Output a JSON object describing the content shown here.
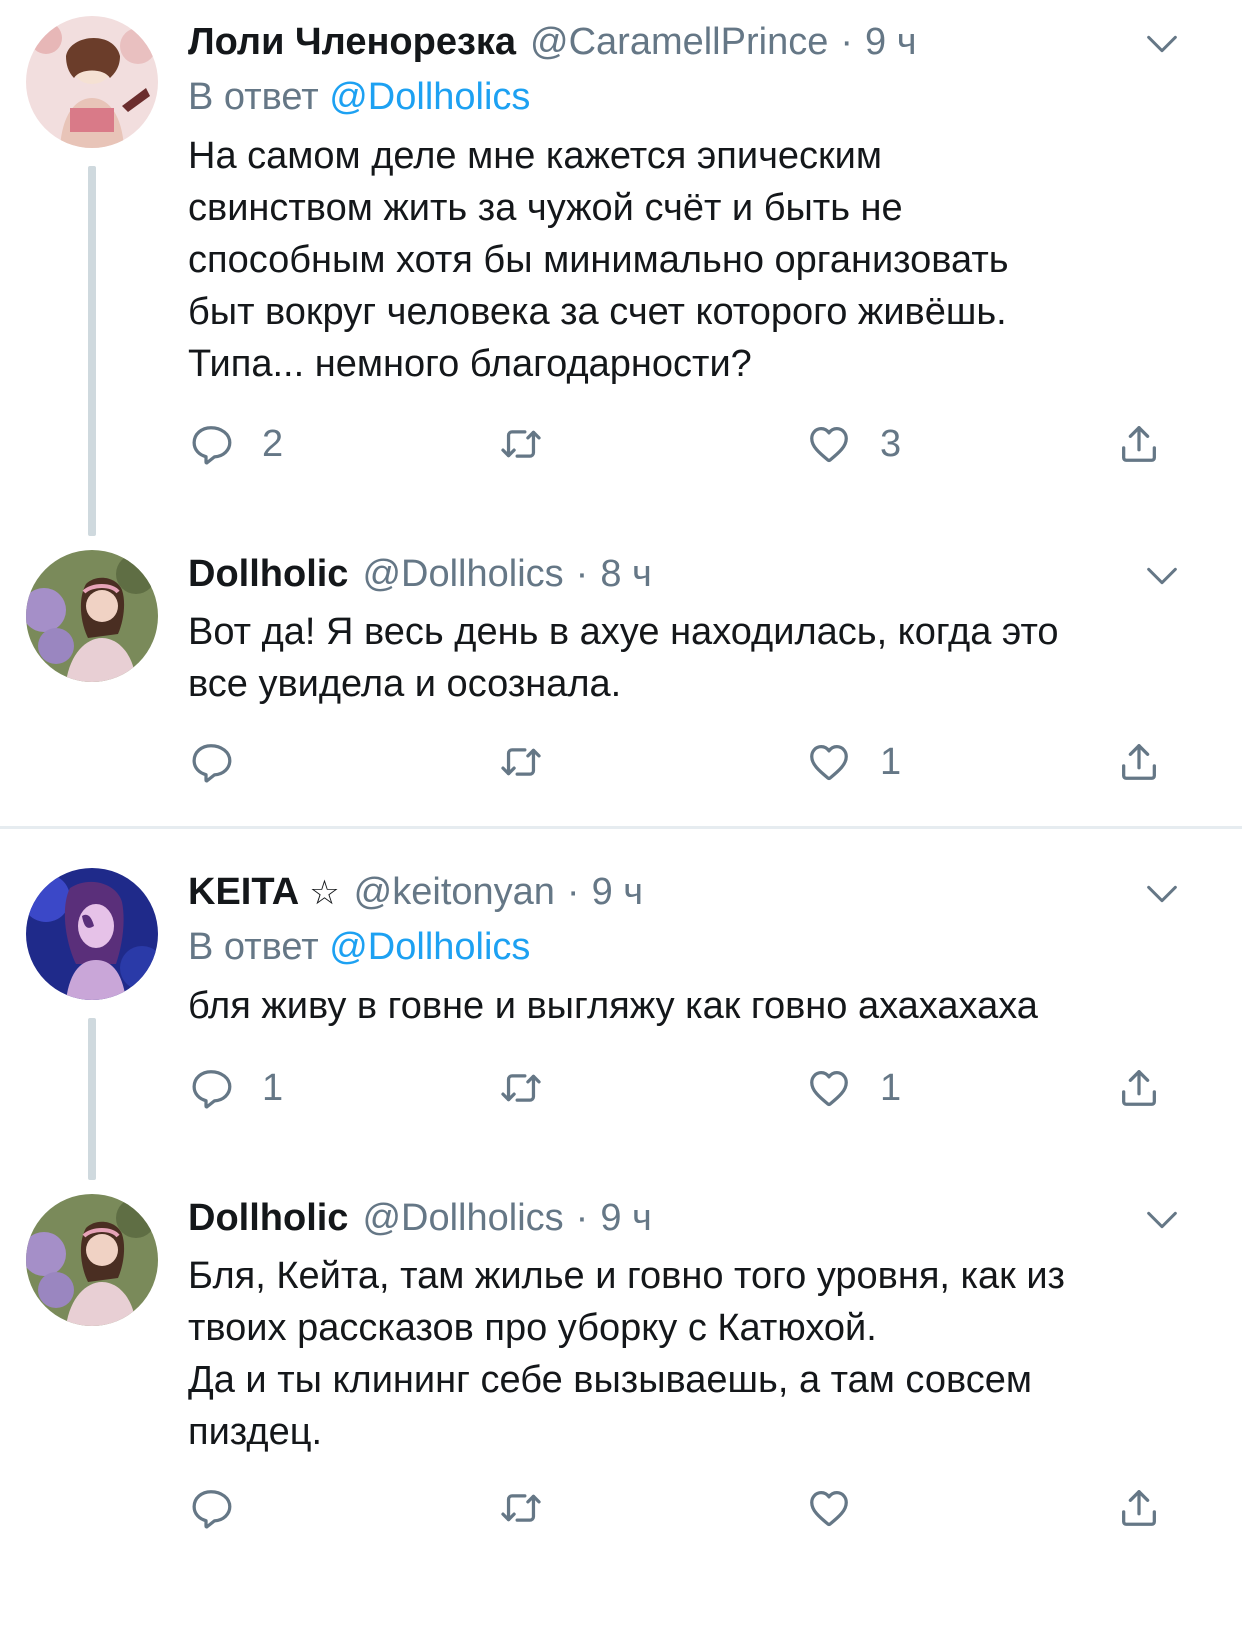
{
  "tweets": [
    {
      "name": "Лоли Членорезка",
      "handle": "@CaramellPrince",
      "sep": "·",
      "time": "9 ч",
      "reply_prefix": "В ответ",
      "reply_mention": "@Dollholics",
      "text": "На самом деле мне кажется эпическим\nсвинством жить за чужой счёт и быть не\nспособным хотя бы минимально организовать\nбыт вокруг человека за счет которого живёшь.\nТипа... немного благодарности?",
      "replies": "2",
      "retweets": "",
      "likes": "3",
      "avatar_icon": "avatar-drawn-girl"
    },
    {
      "name": "Dollholic",
      "handle": "@Dollholics",
      "sep": "·",
      "time": "8 ч",
      "text": "Вот да!  Я весь день в ахуе находилась, когда это\nвсе увидела и осознала.",
      "replies": "",
      "retweets": "",
      "likes": "1",
      "avatar_icon": "avatar-photo-lilac"
    },
    {
      "name": "KEITA",
      "badge": "☆",
      "handle": "@keitonyan",
      "sep": "·",
      "time": "9 ч",
      "reply_prefix": "В ответ",
      "reply_mention": "@Dollholics",
      "text": "бля живу в говне и выгляжу как говно ахахахаха",
      "replies": "1",
      "retweets": "",
      "likes": "1",
      "avatar_icon": "avatar-photo-purple"
    },
    {
      "name": "Dollholic",
      "handle": "@Dollholics",
      "sep": "·",
      "time": "9 ч",
      "text": "Бля, Кейта, там жилье и говно того уровня, как из\nтвоих рассказов про уборку с Катюхой.\nДа и ты клининг себе вызываешь, а там совсем\nпиздец.",
      "replies": "",
      "retweets": "",
      "likes": "",
      "avatar_icon": "avatar-photo-lilac"
    }
  ],
  "colors": {
    "text": "#14171a",
    "secondary": "#657786",
    "link": "#1da1f2",
    "thread_line": "#cfd9de",
    "divider": "#e6ecf0"
  },
  "icons": {
    "reply": "reply-icon",
    "retweet": "retweet-icon",
    "like": "heart-icon",
    "share": "share-icon",
    "menu": "chevron-down-icon"
  }
}
